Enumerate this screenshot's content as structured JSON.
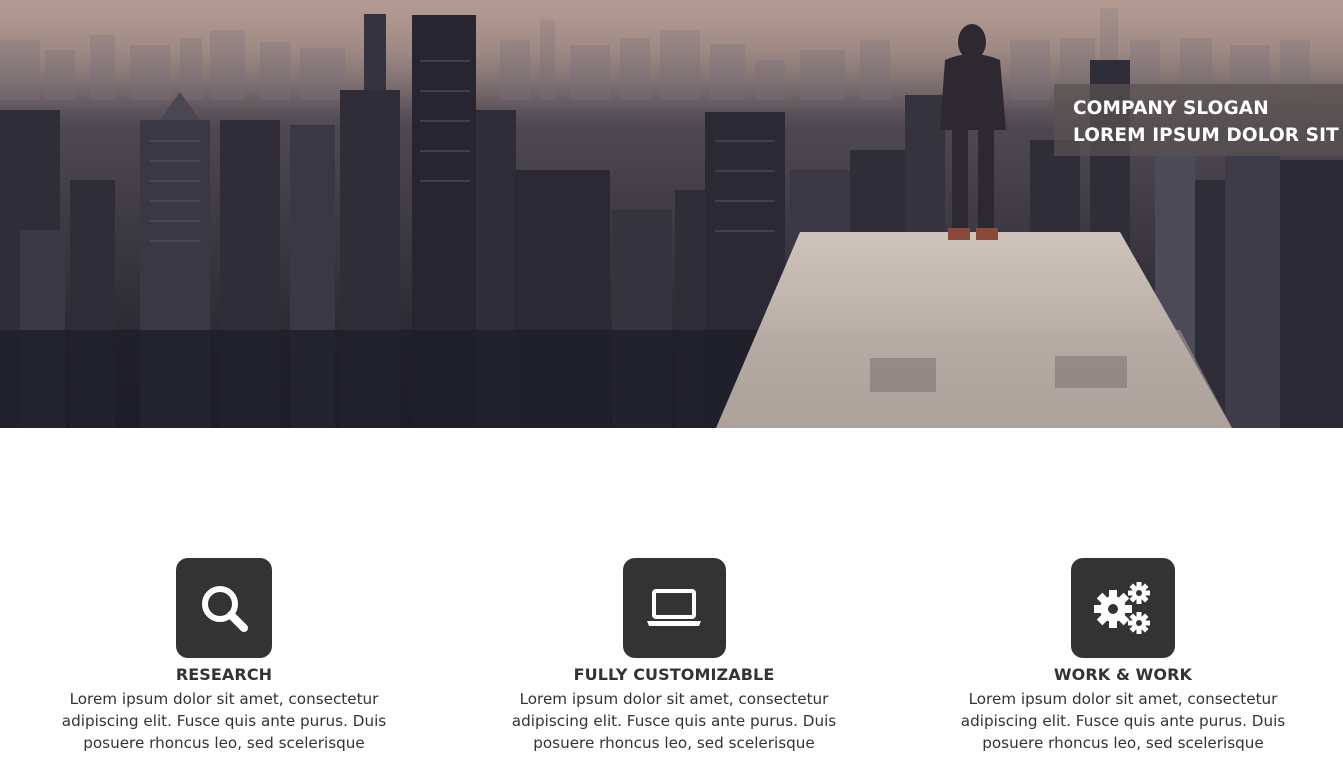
{
  "hero": {
    "slogan_line1": "COMPANY SLOGAN",
    "slogan_line2": "LOREM IPSUM DOLOR SIT"
  },
  "features": [
    {
      "icon": "search-icon",
      "title": "RESEARCH",
      "line1": "Lorem ipsum dolor sit amet, consectetur",
      "line2": "adipiscing elit. Fusce quis ante purus. Duis",
      "line3": "posuere rhoncus leo, sed scelerisque"
    },
    {
      "icon": "laptop-icon",
      "title": "FULLY CUSTOMIZABLE",
      "line1": "Lorem ipsum dolor sit amet, consectetur",
      "line2": "adipiscing elit. Fusce quis ante purus. Duis",
      "line3": "posuere rhoncus leo, sed scelerisque"
    },
    {
      "icon": "gears-icon",
      "title": "WORK & WORK",
      "line1": "Lorem ipsum dolor sit amet, consectetur",
      "line2": "adipiscing elit. Fusce quis ante purus. Duis",
      "line3": "posuere rhoncus leo, sed scelerisque"
    }
  ],
  "colors": {
    "icon_box": "#333333",
    "text": "#333333",
    "slogan_bg": "#5a5250"
  }
}
